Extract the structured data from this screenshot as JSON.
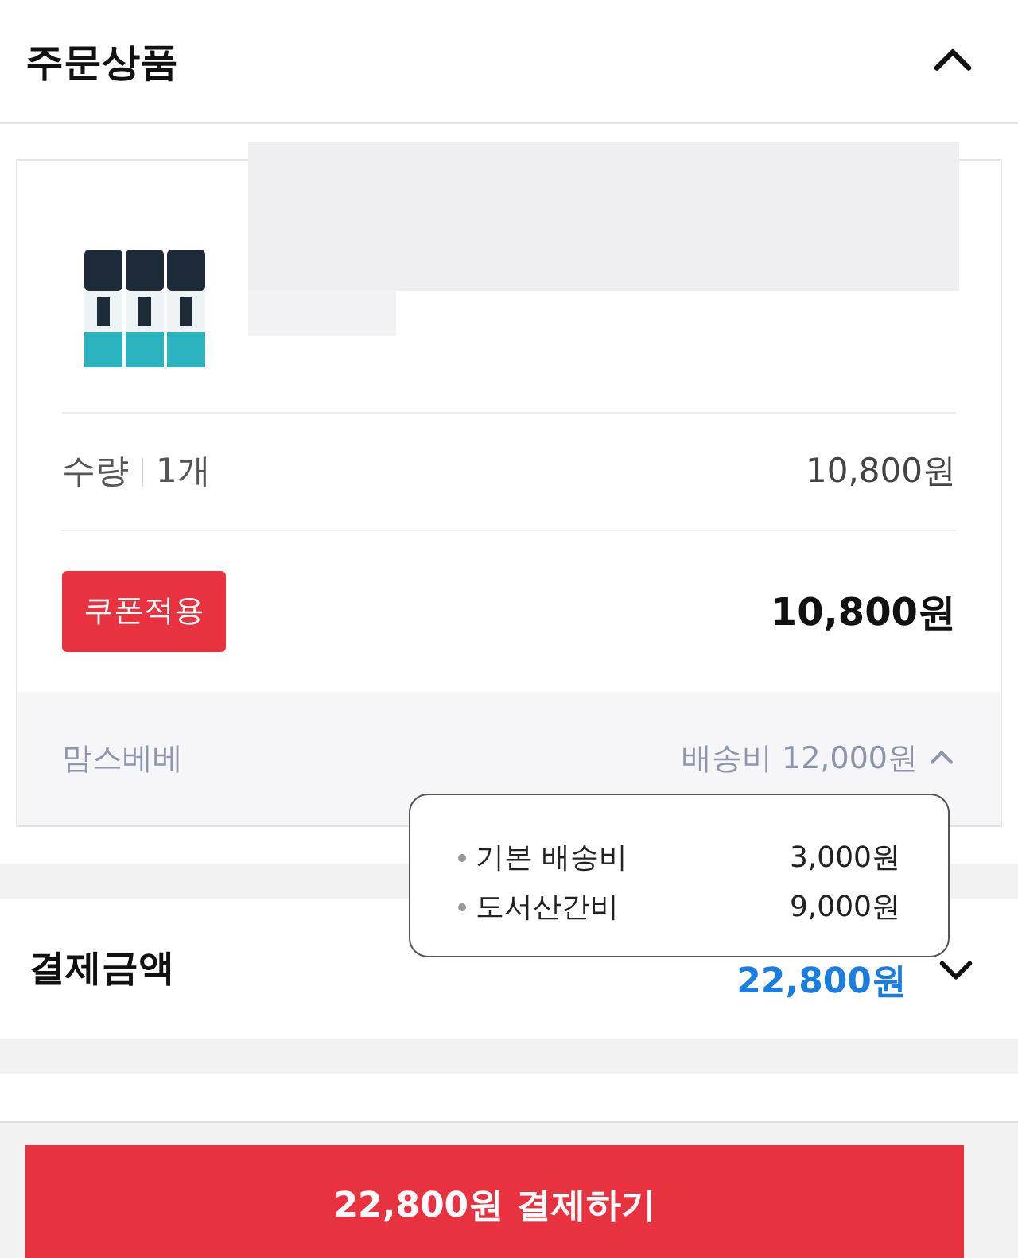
{
  "section": {
    "title": "주문상품",
    "expanded": true
  },
  "product": {
    "quantity_label": "수량",
    "quantity": "1개",
    "price": "10,800원",
    "coupon_button": "쿠폰적용",
    "total": "10,800원"
  },
  "shipping": {
    "seller": "맘스베베",
    "fee": "배송비 12,000원",
    "expanded": true,
    "breakdown": [
      {
        "label": "기본 배송비",
        "amount": "3,000원"
      },
      {
        "label": "도서산간비",
        "amount": "9,000원"
      }
    ]
  },
  "payment": {
    "title": "결제금액",
    "total": "22,800원",
    "expanded": false
  },
  "pay_button": "22,800원 결제하기"
}
